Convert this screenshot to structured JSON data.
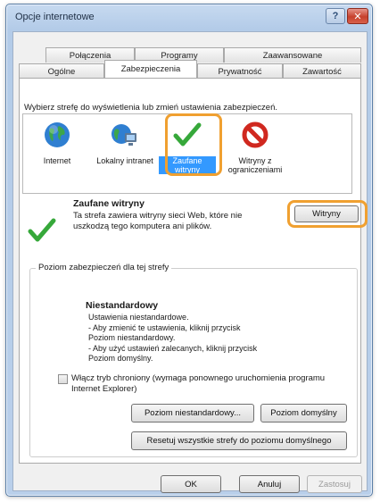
{
  "window": {
    "title": "Opcje internetowe",
    "help_label": "?",
    "close_label": "✕"
  },
  "tabs": {
    "row1": [
      "Połączenia",
      "Programy",
      "Zaawansowane"
    ],
    "row2": [
      "Ogólne",
      "Zabezpieczenia",
      "Prywatność",
      "Zawartość"
    ],
    "active": "Zabezpieczenia"
  },
  "instruction": "Wybierz strefę do wyświetlenia lub zmień ustawienia zabezpieczeń.",
  "zones": [
    {
      "label": "Internet",
      "icon": "globe-icon"
    },
    {
      "label": "Lokalny intranet",
      "icon": "intranet-icon"
    },
    {
      "label": "Zaufane witryny",
      "icon": "checkmark-icon",
      "selected": true
    },
    {
      "label": "Witryny z ograniczeniami",
      "icon": "restricted-icon"
    }
  ],
  "zone_info": {
    "title": "Zaufane witryny",
    "description": "Ta strefa zawiera witryny sieci Web, które nie uszkodzą tego komputera ani plików.",
    "sites_button": "Witryny"
  },
  "security_level": {
    "group_label": "Poziom zabezpieczeń dla tej strefy",
    "title": "Niestandardowy",
    "lines": [
      "Ustawienia niestandardowe.",
      "- Aby zmienić te ustawienia, kliknij przycisk Poziom niestandardowy.",
      "- Aby użyć ustawień zalecanych, kliknij przycisk Poziom domyślny."
    ],
    "protected_mode_label": "Włącz tryb chroniony (wymaga ponownego uruchomienia programu Internet Explorer)",
    "protected_mode_checked": false,
    "custom_level_button": "Poziom niestandardowy...",
    "default_level_button": "Poziom domyślny",
    "reset_button": "Resetuj wszystkie strefy do poziomu domyślnego"
  },
  "footer": {
    "ok": "OK",
    "cancel": "Anuluj",
    "apply": "Zastosuj"
  },
  "colors": {
    "highlight": "#f0a030",
    "selection": "#3399ff",
    "check_green": "#36a83a",
    "restricted_red": "#d0281f"
  }
}
